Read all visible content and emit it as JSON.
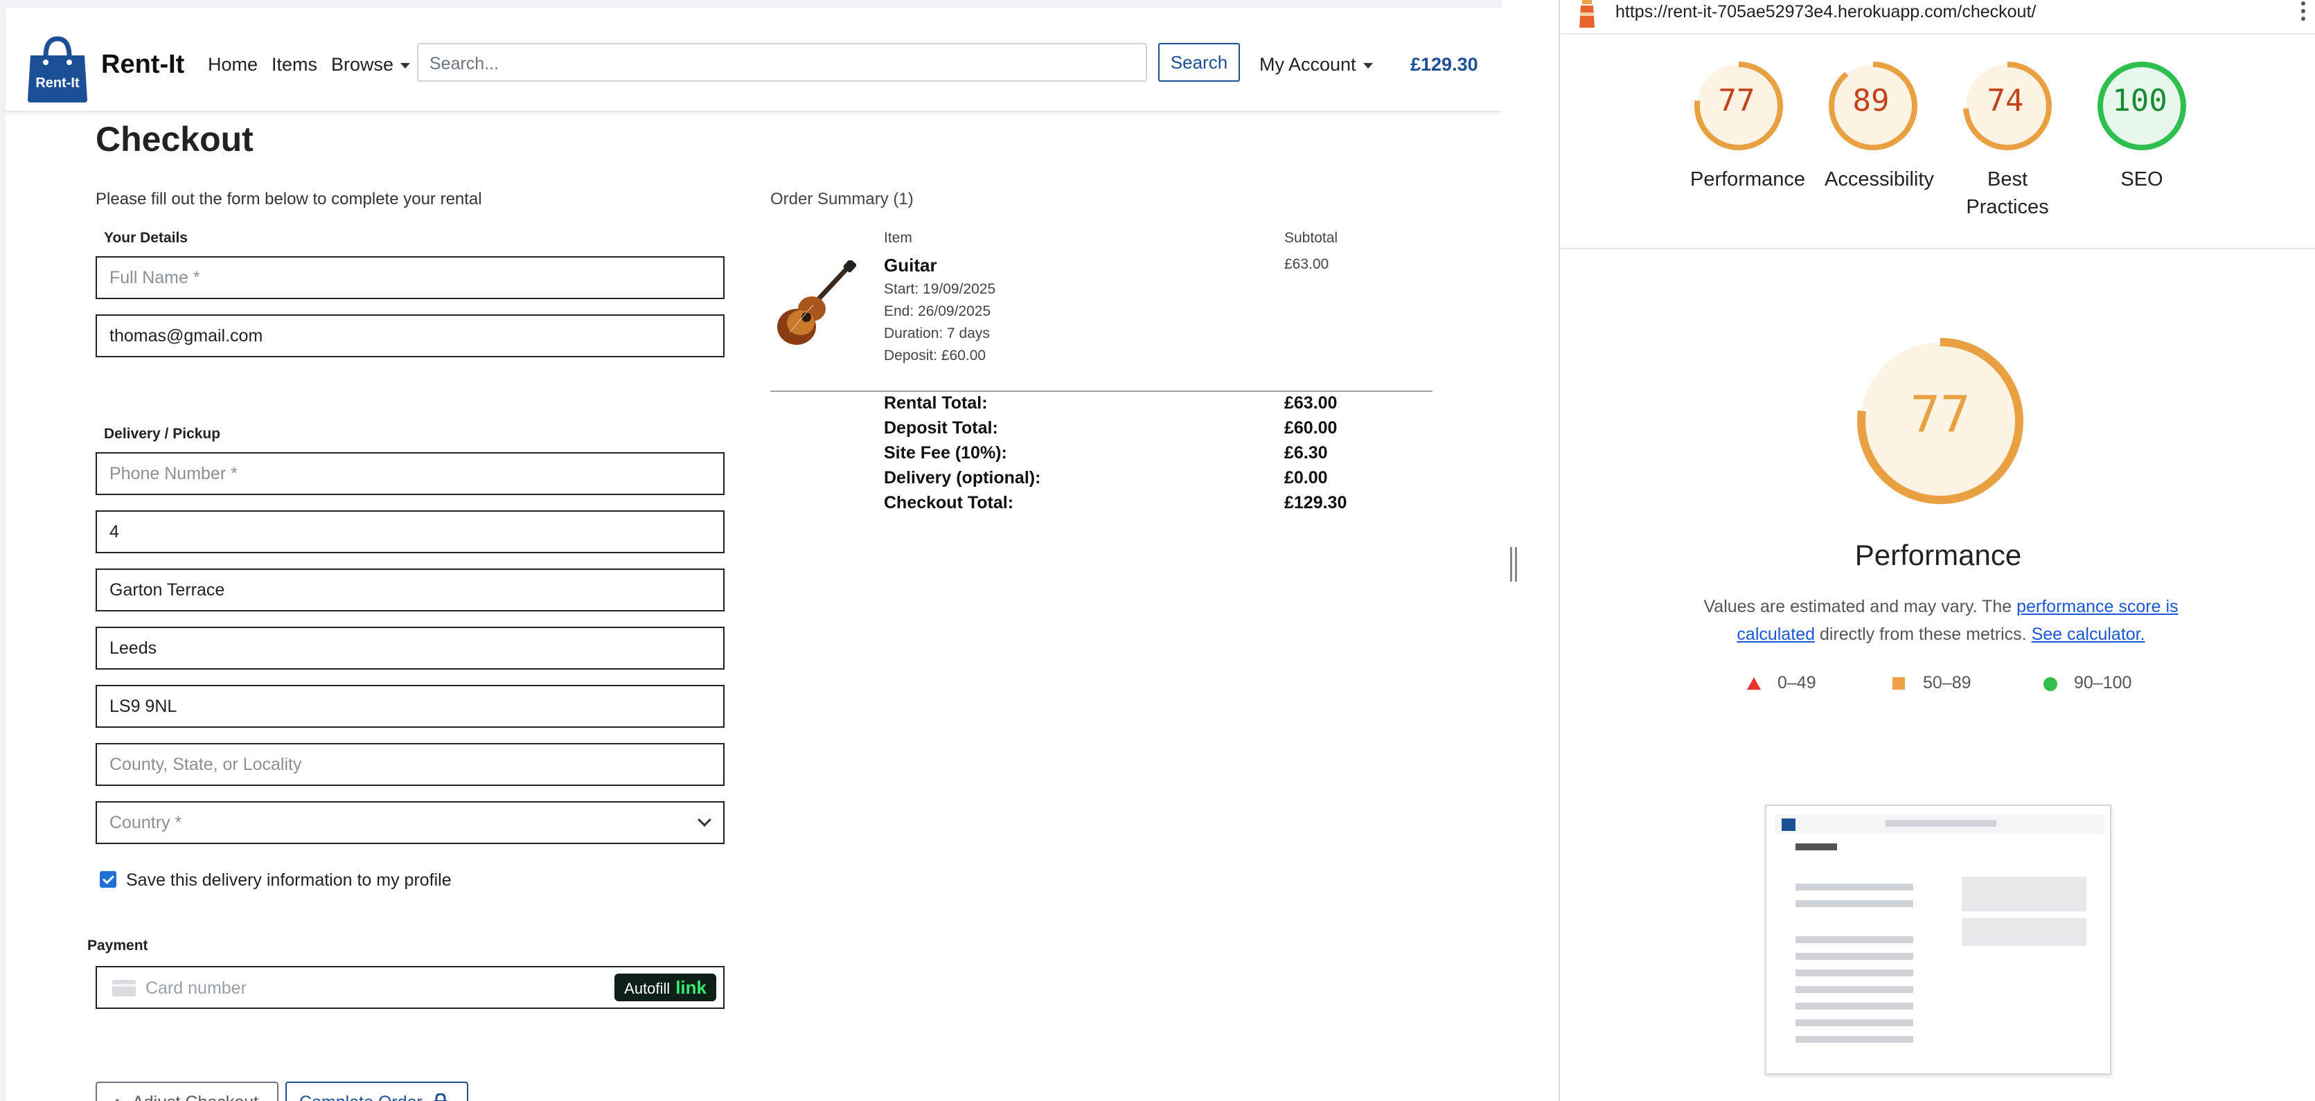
{
  "nav": {
    "brand": "Rent-It",
    "logo_text": "Rent-It",
    "home": "Home",
    "items": "Items",
    "browse": "Browse",
    "search_placeholder": "Search...",
    "search_button": "Search",
    "account": "My Account",
    "cart_total": "£129.30"
  },
  "checkout": {
    "title": "Checkout",
    "intro": "Please fill out the form below to complete your rental",
    "your_details_label": "Your Details",
    "full_name_placeholder": "Full Name *",
    "email_value": "thomas@gmail.com",
    "delivery_label": "Delivery / Pickup",
    "phone_placeholder": "Phone Number *",
    "address_number": "4",
    "street": "Garton Terrace",
    "city": "Leeds",
    "postcode": "LS9 9NL",
    "county_placeholder": "County, State, or Locality",
    "country_placeholder": "Country *",
    "save_delivery_label": "Save this delivery information to my profile",
    "payment_label": "Payment",
    "card_placeholder": "Card number",
    "autofill_text": "Autofill",
    "autofill_link": "link",
    "adjust_button": "Adjust Checkout",
    "complete_button": "Complete Order"
  },
  "order_summary": {
    "title": "Order Summary (1)",
    "col_item": "Item",
    "col_subtotal": "Subtotal",
    "item_name": "Guitar",
    "start": "Start: 19/09/2025",
    "end": "End: 26/09/2025",
    "duration": "Duration: 7 days",
    "deposit": "Deposit: £60.00",
    "item_subtotal": "£63.00",
    "totals": [
      {
        "label": "Rental Total:",
        "value": "£63.00"
      },
      {
        "label": "Deposit Total:",
        "value": "£60.00"
      },
      {
        "label": "Site Fee (10%):",
        "value": "£6.30"
      },
      {
        "label": "Delivery (optional):",
        "value": "£0.00"
      },
      {
        "label": "Checkout Total:",
        "value": "£129.30"
      }
    ]
  },
  "lighthouse": {
    "url": "https://rent-it-705ae52973e4.herokuapp.com/checkout/",
    "scores": [
      {
        "label": "Performance",
        "value": 77,
        "color": "#e8a041",
        "text_color": "#c4421a",
        "bg": "#fdf3e4"
      },
      {
        "label": "Accessibility",
        "value": 89,
        "color": "#e8a041",
        "text_color": "#c4421a",
        "bg": "#fdf3e4"
      },
      {
        "label": "Best Practices",
        "value": 74,
        "color": "#e8a041",
        "text_color": "#c4421a",
        "bg": "#fdf3e4"
      },
      {
        "label": "SEO",
        "value": 100,
        "color": "#2fbf4f",
        "text_color": "#1a8a33",
        "bg": "#e8f7ec"
      }
    ],
    "main_score": 77,
    "main_label": "Performance",
    "desc_prefix": "Values are estimated and may vary. The ",
    "desc_link1": "performance score is calculated",
    "desc_middle": " directly from these metrics. ",
    "desc_link2": "See calculator.",
    "legend": [
      {
        "label": "0–49"
      },
      {
        "label": "50–89"
      },
      {
        "label": "90–100"
      }
    ]
  }
}
